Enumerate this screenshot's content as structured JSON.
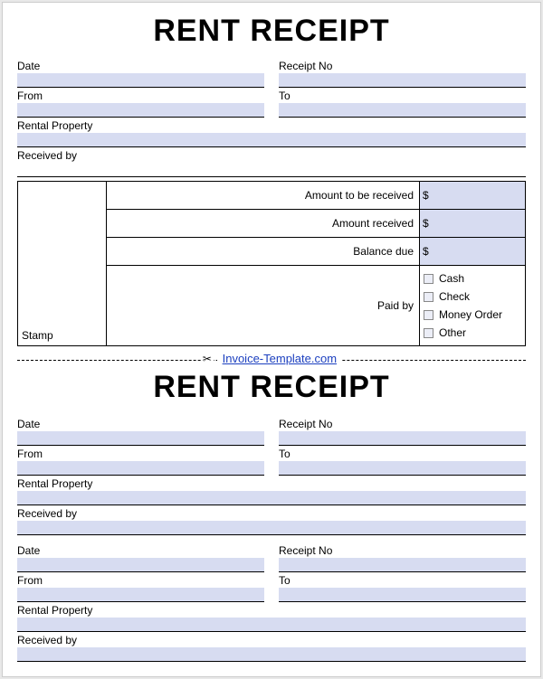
{
  "receipt1": {
    "title": "RENT RECEIPT",
    "date_label": "Date",
    "receipt_no_label": "Receipt No",
    "from_label": "From",
    "to_label": "To",
    "rental_property_label": "Rental Property",
    "received_by_label": "Received by",
    "stamp_label": "Stamp",
    "amount_to_be_received_label": "Amount to be received",
    "amount_received_label": "Amount received",
    "balance_due_label": "Balance due",
    "paid_by_label": "Paid by",
    "currency_symbol": "$",
    "pay_methods": {
      "cash": "Cash",
      "check": "Check",
      "money_order": "Money Order",
      "other": "Other"
    }
  },
  "cut": {
    "scissor": "✂",
    "link_text": "Invoice-Template.com"
  },
  "receipt2": {
    "title": "RENT RECEIPT",
    "date_label": "Date",
    "receipt_no_label": "Receipt No",
    "from_label": "From",
    "to_label": "To",
    "rental_property_label": "Rental Property",
    "received_by_label": "Received by"
  },
  "receipt3": {
    "date_label": "Date",
    "receipt_no_label": "Receipt No",
    "from_label": "From",
    "to_label": "To",
    "rental_property_label": "Rental Property",
    "received_by_label": "Received by"
  }
}
